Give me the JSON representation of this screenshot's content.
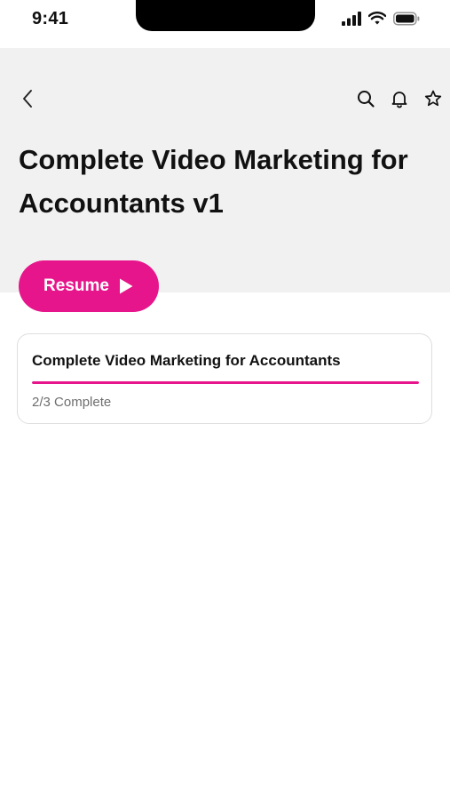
{
  "status_bar": {
    "time": "9:41",
    "icons": [
      "cellular-signal-icon",
      "wifi-icon",
      "battery-icon"
    ]
  },
  "nav": {
    "back_icon": "chevron-left-icon",
    "actions": [
      "search-icon",
      "bell-icon",
      "star-icon"
    ]
  },
  "page": {
    "title": "Complete Video Marketing for Accountants v1"
  },
  "resume_button": {
    "label": "Resume",
    "icon": "play-icon"
  },
  "course_card": {
    "title": "Complete Video Marketing for Accountants",
    "progress_text": "2/3 Complete",
    "progress_fraction": 1.0
  },
  "colors": {
    "accent": "#e6158b",
    "header_background": "#f1f1f1",
    "text_primary": "#111111",
    "text_secondary": "#6e6e6e"
  }
}
